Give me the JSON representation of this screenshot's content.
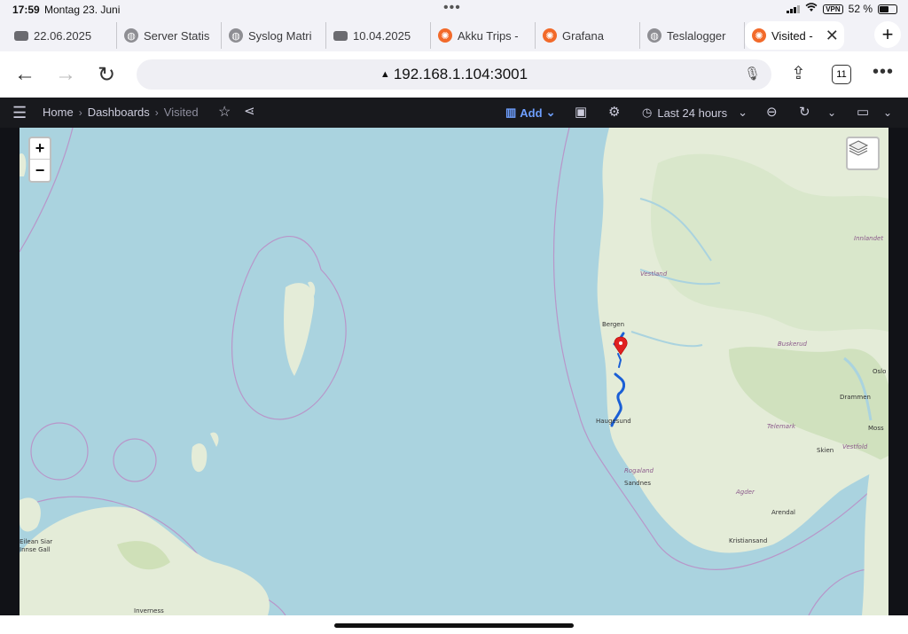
{
  "status": {
    "time": "17:59",
    "date": "Montag 23. Juni",
    "vpn": "VPN",
    "battery": "52 %"
  },
  "tabs": [
    {
      "label": "22.06.2025",
      "icon": "image-icon"
    },
    {
      "label": "Server Statis",
      "icon": "globe-icon"
    },
    {
      "label": "Syslog Matri",
      "icon": "globe-icon"
    },
    {
      "label": "10.04.2025",
      "icon": "image-icon"
    },
    {
      "label": "Akku Trips -",
      "icon": "grafana-icon"
    },
    {
      "label": "Grafana",
      "icon": "grafana-icon"
    },
    {
      "label": "Teslalogger",
      "icon": "globe-icon"
    },
    {
      "label": "Visited -",
      "icon": "grafana-icon",
      "active": true
    }
  ],
  "address": {
    "url": "192.168.1.104:3001",
    "tab_count": "11"
  },
  "toolbar": {
    "breadcrumb_home": "Home",
    "breadcrumb_dashboards": "Dashboards",
    "breadcrumb_current": "Visited",
    "add_label": "Add",
    "time_range": "Last 24 hours",
    "accent": "#6e9fff"
  },
  "map": {
    "zoom_in": "+",
    "zoom_out": "−",
    "labels": {
      "bergen": "Bergen",
      "haugesund": "Haugesund",
      "sandnes": "Sandnes",
      "arendal": "Arendal",
      "kristiansand": "Kristiansand",
      "oslo": "Oslo",
      "drammen": "Drammen",
      "moss": "Moss",
      "skien": "Skien",
      "inverness": "Inverness",
      "vestland": "Vestland",
      "rogaland": "Rogaland",
      "agder": "Agder",
      "telemark": "Telemark",
      "buskerud": "Buskerud",
      "vestfold": "Vestfold",
      "innlandet": "Innlandet",
      "eilean": "Eilean Siar",
      "eilean2": "Innse Gall"
    },
    "route_color": "#1a5fd6",
    "marker_color": "#e02020"
  }
}
